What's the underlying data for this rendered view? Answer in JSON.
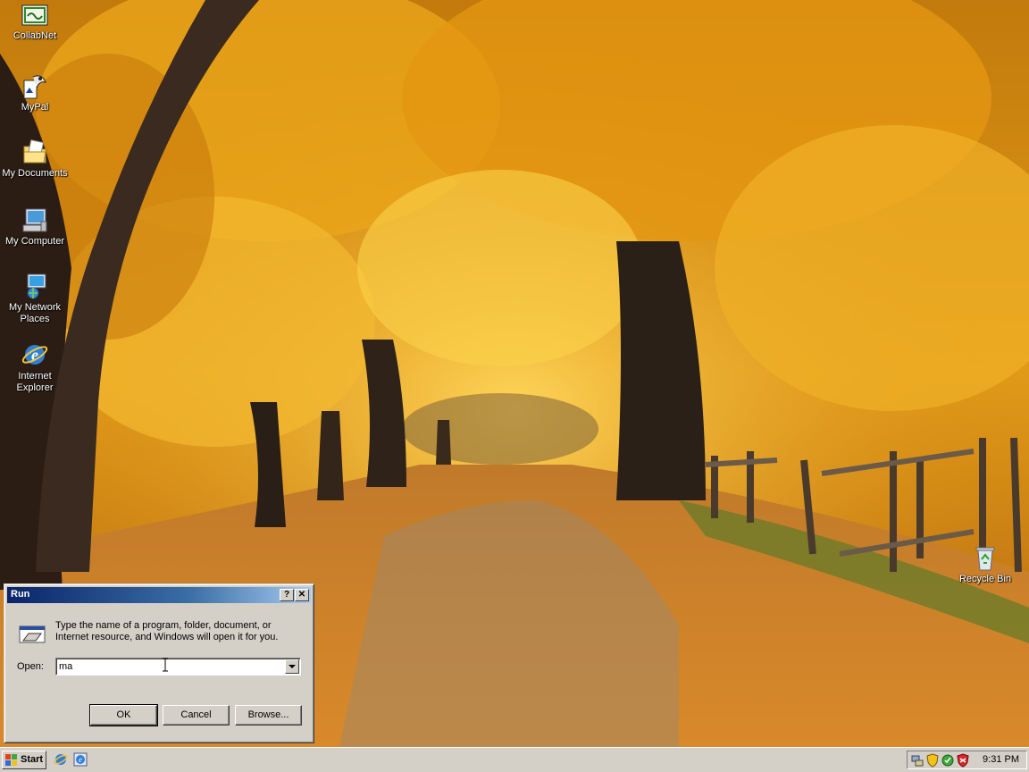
{
  "desktop": {
    "icons": [
      {
        "label": "CollabNet"
      },
      {
        "label": "MyPal"
      },
      {
        "label": "My Documents"
      },
      {
        "label": "My Computer"
      },
      {
        "label": "My Network Places"
      },
      {
        "label": "Internet Explorer"
      },
      {
        "label": "Recycle Bin"
      }
    ]
  },
  "run_dialog": {
    "title": "Run",
    "help_glyph": "?",
    "close_glyph": "✕",
    "description": "Type the name of a program, folder, document, or Internet resource, and Windows will open it for you.",
    "open_label": "Open:",
    "open_value": "ma",
    "buttons": {
      "ok": "OK",
      "cancel": "Cancel",
      "browse": "Browse..."
    }
  },
  "taskbar": {
    "start_label": "Start",
    "quick_launch": [
      "internet-explorer-icon",
      "ie-alt-icon"
    ],
    "tray_icons": [
      "network-tray-icon",
      "shield-tray-icon",
      "antivirus-tray-icon",
      "security-tray-icon"
    ],
    "clock": "9:31 PM"
  },
  "colors": {
    "titlebar_start": "#0a246a",
    "titlebar_end": "#a6caf0",
    "face": "#d4d0c8"
  }
}
